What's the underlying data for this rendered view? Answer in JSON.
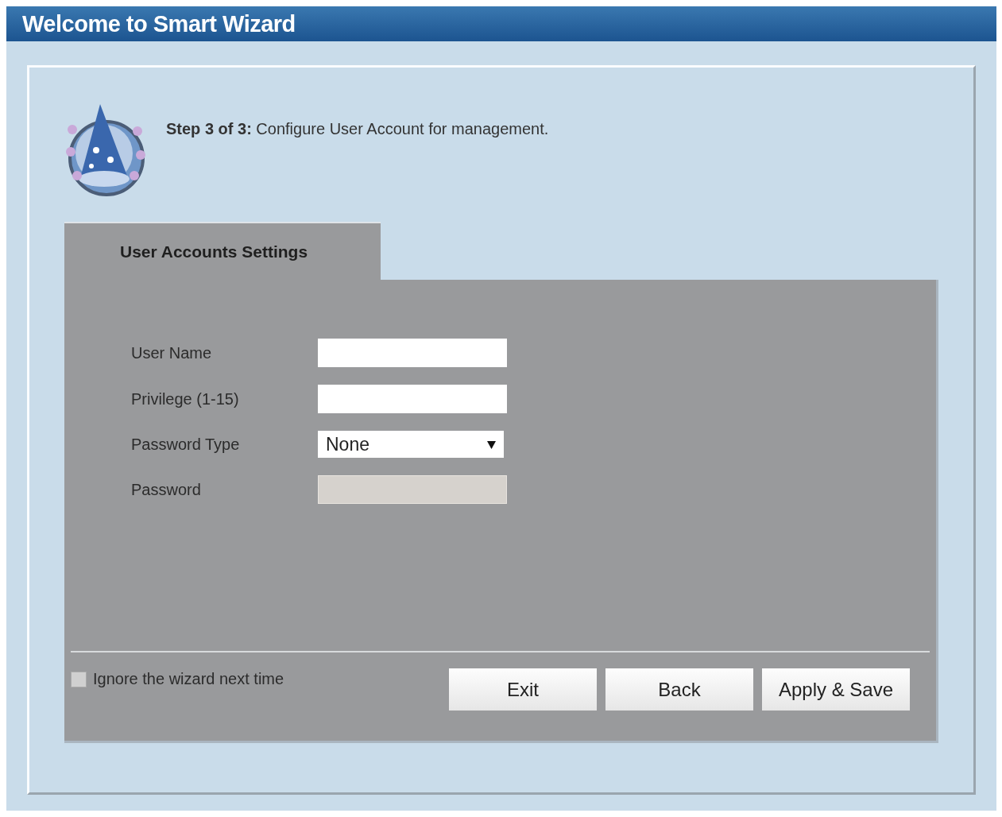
{
  "window": {
    "title": "Welcome to Smart Wizard"
  },
  "step": {
    "text": "**Step 3 of 3:** Configure User Account for management."
  },
  "tabs": [
    {
      "label": "User Accounts Settings",
      "selected": true
    }
  ],
  "fields": [
    {
      "kind": "text",
      "label": "User Name",
      "disabled": false
    },
    {
      "kind": "text",
      "label": "Privilege (1-15)",
      "disabled": false
    },
    {
      "kind": "select",
      "label": "Password Type",
      "value": "None",
      "disabled": false
    },
    {
      "kind": "text",
      "label": "Password",
      "disabled": true
    }
  ],
  "ignore_next_time": {
    "label": "Ignore the wizard next time",
    "checked": false
  },
  "buttons": [
    "Exit",
    "Back",
    "Apply & Save"
  ]
}
